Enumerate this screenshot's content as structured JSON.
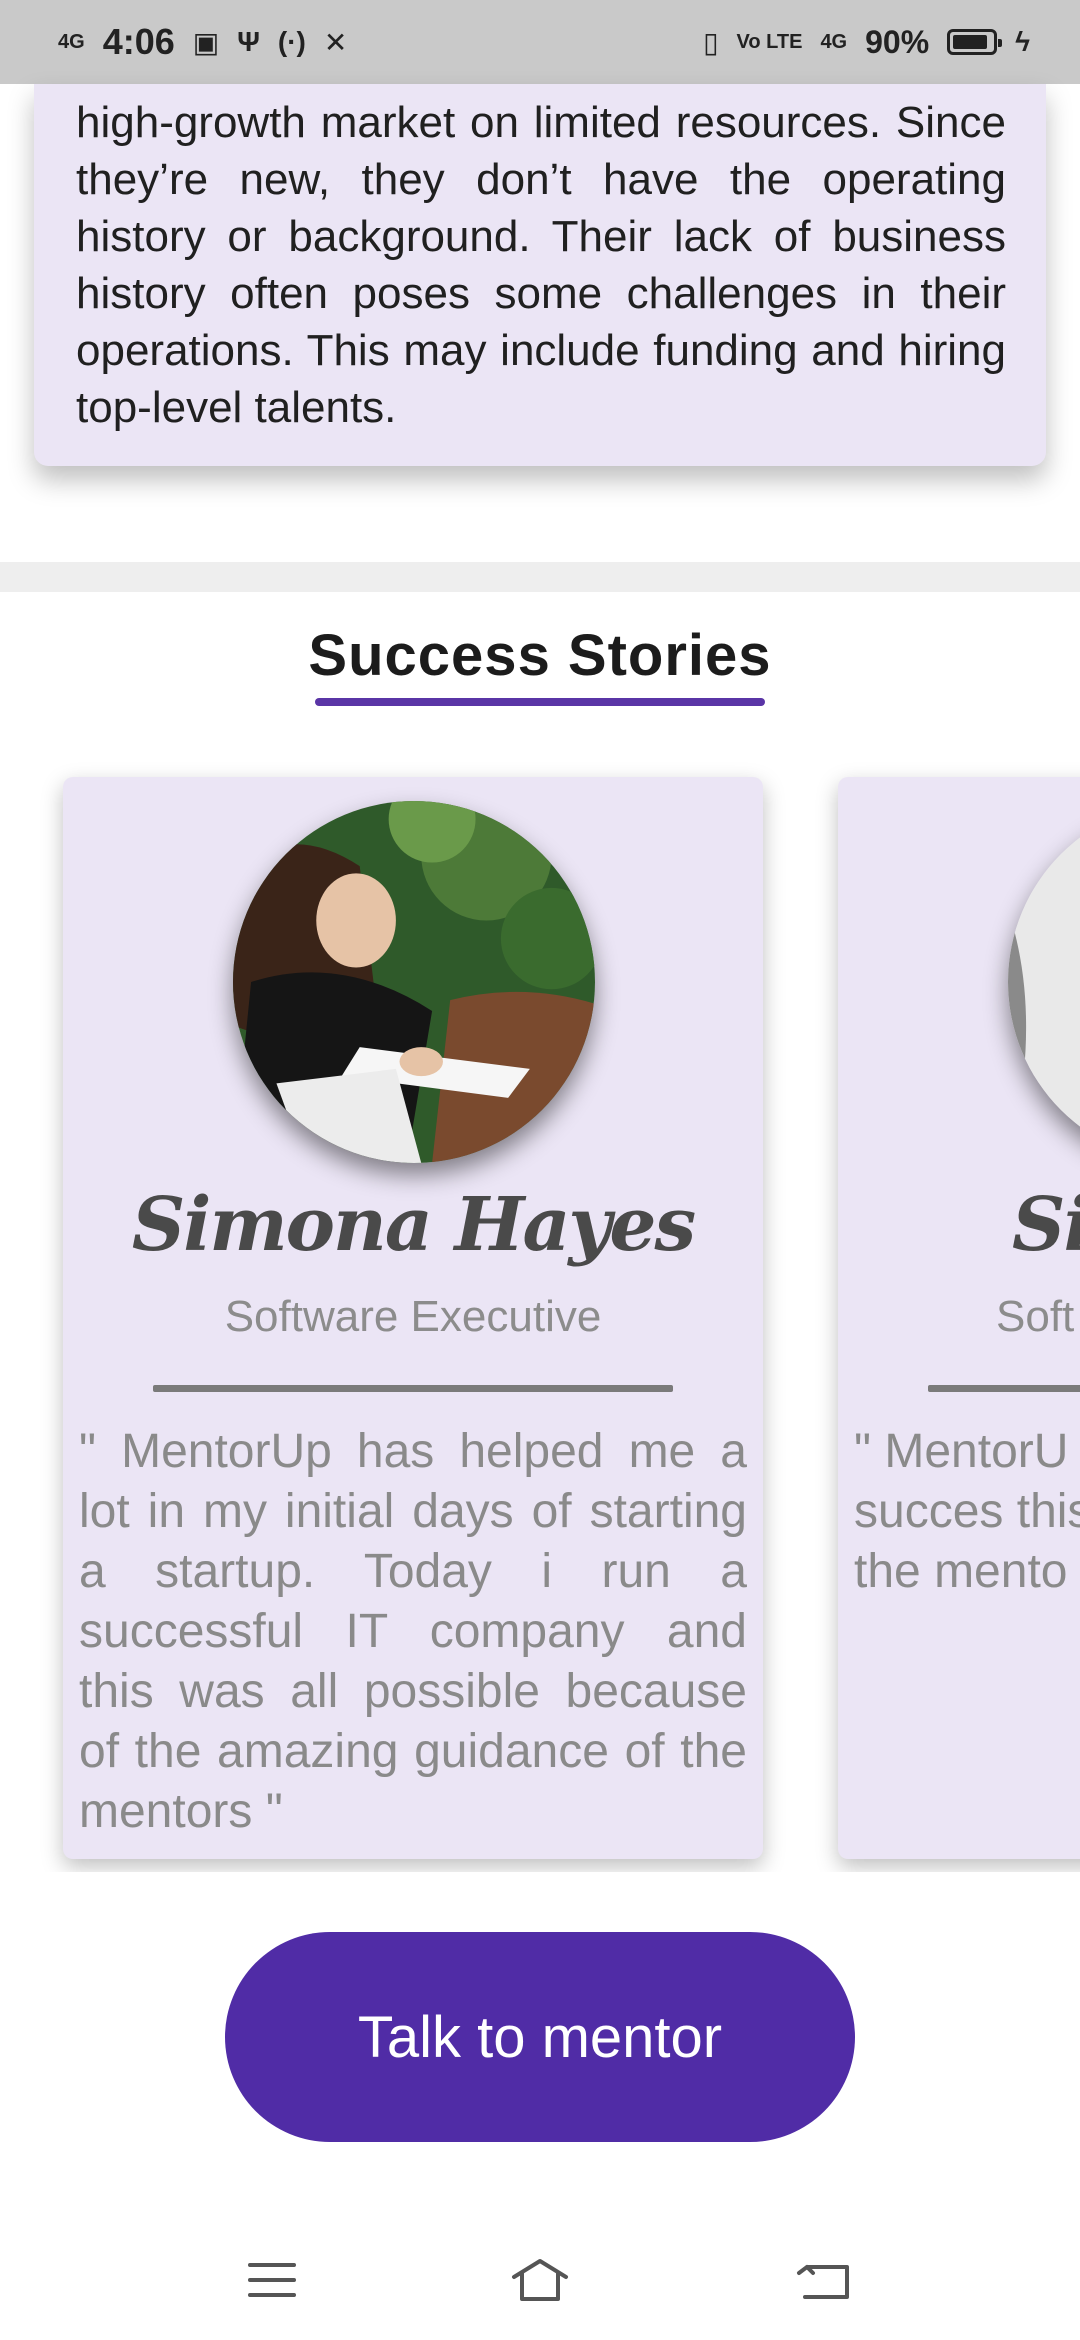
{
  "status_bar": {
    "network_left": "4G",
    "time": "4:06",
    "volte": "Vo LTE",
    "network_right": "4G",
    "battery_percent": "90%",
    "battery_level": 0.9
  },
  "intro": {
    "text": "high-growth market on limited resources. Since they’re new, they don’t have the operating history or background. Their lack of business history often poses some challenges in their operations. This may include funding and hiring top-level talents."
  },
  "success_stories": {
    "title": "Success Stories",
    "stories": [
      {
        "name": "Simona Hayes",
        "role": "Software Executive",
        "quote": "\" MentorUp has helped me a lot in my initial days of starting a startup. Today i run a successful IT company and this was all possible because of the amazing guidance of the mentors \""
      },
      {
        "name": "Si",
        "role": "Soft",
        "quote": "\" MentorU lot in m starting a a succes this was a of the am the mento"
      }
    ]
  },
  "cta": {
    "label": "Talk to mentor"
  },
  "nav_bar": {
    "icons": [
      "menu-icon",
      "home-icon",
      "back-icon"
    ]
  },
  "colors": {
    "accent": "#502ca6",
    "card_bg": "#ebe5f5",
    "underline": "#5a35a6"
  }
}
